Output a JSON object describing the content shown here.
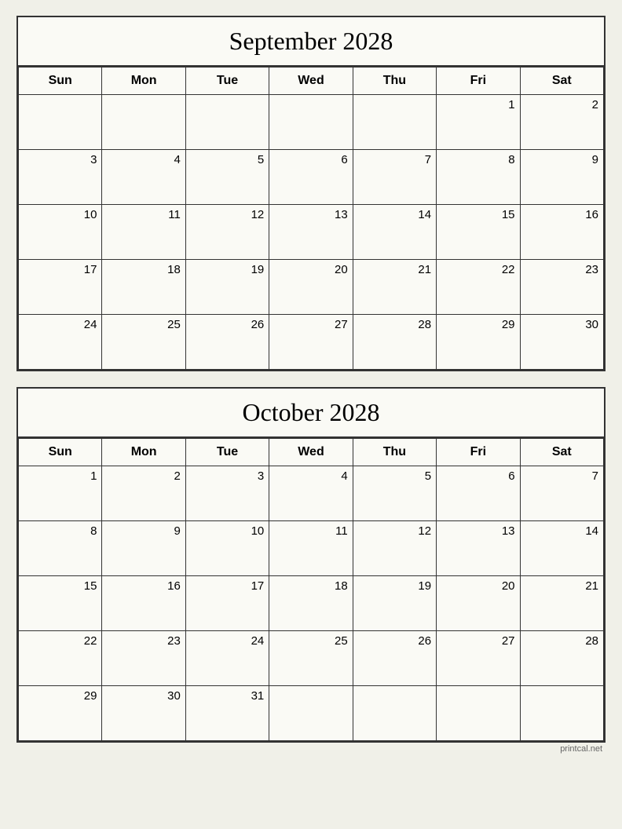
{
  "september": {
    "title": "September 2028",
    "days_of_week": [
      "Sun",
      "Mon",
      "Tue",
      "Wed",
      "Thu",
      "Fri",
      "Sat"
    ],
    "weeks": [
      [
        "",
        "",
        "",
        "",
        "",
        "1",
        "2"
      ],
      [
        "3",
        "4",
        "5",
        "6",
        "7",
        "8",
        "9"
      ],
      [
        "10",
        "11",
        "12",
        "13",
        "14",
        "15",
        "16"
      ],
      [
        "17",
        "18",
        "19",
        "20",
        "21",
        "22",
        "23"
      ],
      [
        "24",
        "25",
        "26",
        "27",
        "28",
        "29",
        "30"
      ]
    ]
  },
  "october": {
    "title": "October 2028",
    "days_of_week": [
      "Sun",
      "Mon",
      "Tue",
      "Wed",
      "Thu",
      "Fri",
      "Sat"
    ],
    "weeks": [
      [
        "1",
        "2",
        "3",
        "4",
        "5",
        "6",
        "7"
      ],
      [
        "8",
        "9",
        "10",
        "11",
        "12",
        "13",
        "14"
      ],
      [
        "15",
        "16",
        "17",
        "18",
        "19",
        "20",
        "21"
      ],
      [
        "22",
        "23",
        "24",
        "25",
        "26",
        "27",
        "28"
      ],
      [
        "29",
        "30",
        "31",
        "",
        "",
        "",
        ""
      ]
    ]
  },
  "watermark": "printcal.net"
}
